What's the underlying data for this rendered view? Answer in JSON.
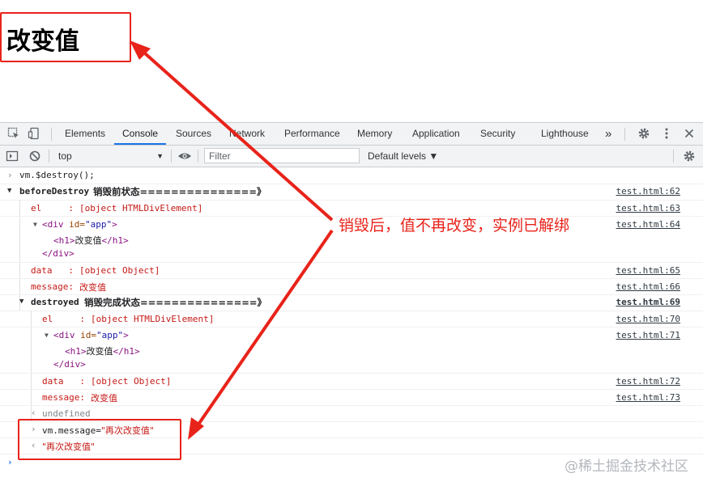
{
  "page": {
    "heading": "改变值"
  },
  "devtools": {
    "tabs": [
      "Elements",
      "Console",
      "Sources",
      "Network",
      "Performance",
      "Memory",
      "Application",
      "Security",
      "Lighthouse"
    ],
    "more_tabs": "»",
    "active_tab": "Console",
    "context": "top",
    "filter_placeholder": "Filter",
    "levels": "Default levels ▼"
  },
  "console": {
    "cmd1": "vm.$destroy();",
    "before_label": "beforeDestroy",
    "before_text": "销毁前状态===============》",
    "before_src": "test.html:62",
    "el_label": "el     : ",
    "el_value": "[object HTMLDivElement]",
    "el_src1": "test.html:63",
    "div_open": "<div",
    "div_attr_name": " id=",
    "div_attr_value": "\"app\"",
    "div_close_bracket": ">",
    "h1_open": "<h1>",
    "h1_text": "改变值",
    "h1_close": "</h1>",
    "div_end": "</div>",
    "div_src1": "test.html:64",
    "data_label": "data   : ",
    "data_value": "[object Object]",
    "data_src1": "test.html:65",
    "msg_label": "message: ",
    "msg_value": "改变值",
    "msg_src1": "test.html:66",
    "destroyed_label": "destroyed",
    "destroyed_text": "销毁完成状态===============》",
    "destroyed_src": "test.html:69",
    "el_src2": "test.html:70",
    "div_src2": "test.html:71",
    "data_src2": "test.html:72",
    "msg_src2": "test.html:73",
    "undefined": "undefined",
    "cmd2_prefix": "vm.message=",
    "cmd2_value": "\"再次改变值\"",
    "result2": "\"再次改变值\""
  },
  "annotation": "销毁后，值不再改变，实例已解绑",
  "watermark": "@稀土掘金技术社区",
  "colors": {
    "annotation_red": "#e8231a",
    "active_tab_underline": "#1a73e8",
    "error_red": "#c41a16"
  }
}
